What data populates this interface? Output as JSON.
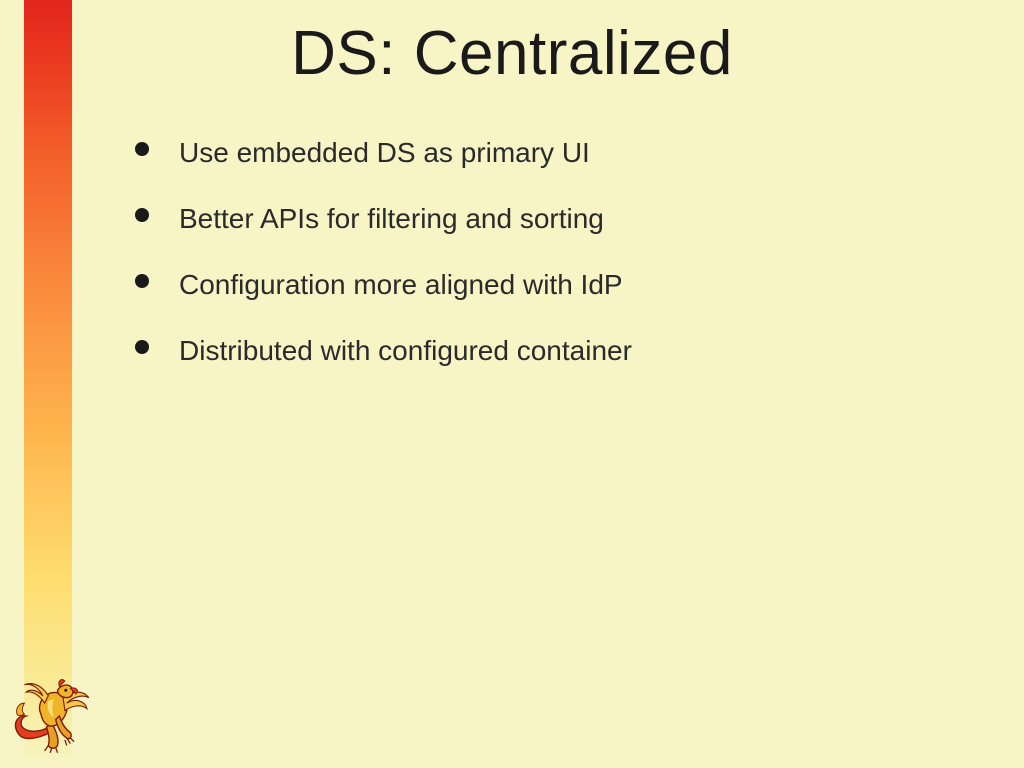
{
  "slide": {
    "title": "DS: Centralized",
    "bullets": [
      "Use embedded DS as primary UI",
      "Better APIs for filtering and sorting",
      "Configuration more aligned with IdP",
      "Distributed with configured container"
    ]
  },
  "theme": {
    "background": "#f7f4c6",
    "accent_gradient_top": "#e1261c",
    "accent_gradient_bottom": "#f7f4c6",
    "text_color": "#1a1a1a"
  },
  "logo": {
    "name": "griffin-icon"
  }
}
